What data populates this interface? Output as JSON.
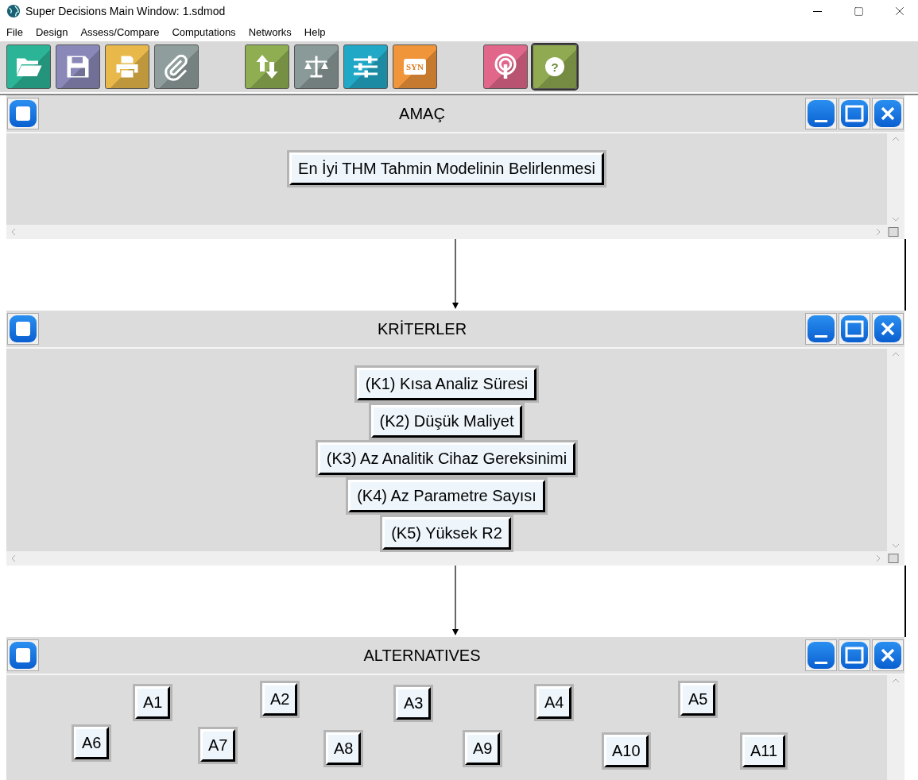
{
  "window": {
    "title": "Super Decisions Main Window: 1.sdmod"
  },
  "menu": [
    "File",
    "Design",
    "Assess/Compare",
    "Computations",
    "Networks",
    "Help"
  ],
  "toolbar": [
    {
      "kind": "open",
      "color": "#2bb596"
    },
    {
      "kind": "save",
      "color": "#8a88b8"
    },
    {
      "kind": "print",
      "color": "#e8b84a"
    },
    {
      "kind": "attach",
      "color": "#8f9e9c"
    },
    {
      "kind": "gap"
    },
    {
      "kind": "refresh",
      "color": "#8fae52"
    },
    {
      "kind": "scale",
      "color": "#8a9a98"
    },
    {
      "kind": "sliders",
      "color": "#21a8c6"
    },
    {
      "kind": "text",
      "color": "#f0953a",
      "label": "SYN"
    },
    {
      "kind": "gap"
    },
    {
      "kind": "broadcast",
      "color": "#e0668a"
    },
    {
      "kind": "help",
      "color": "#8faa50",
      "label": "?"
    }
  ],
  "clusters": [
    {
      "title": "AMAÇ",
      "kind": "column",
      "nodes": [
        "En İyi THM Tahmin Modelinin Belirlenmesi"
      ]
    },
    {
      "title": "KRİTERLER",
      "kind": "column",
      "nodes": [
        "(K1) Kısa Analiz Süresi",
        "(K2) Düşük Maliyet",
        "(K3) Az Analitik Cihaz Gereksinimi",
        "(K4) Az Parametre Sayısı",
        "(K5) Yüksek R2"
      ]
    },
    {
      "title": "ALTERNATIVES",
      "kind": "free",
      "nodes": [
        "A1",
        "A2",
        "A3",
        "A4",
        "A5",
        "A6",
        "A7",
        "A8",
        "A9",
        "A10",
        "A11"
      ]
    }
  ]
}
